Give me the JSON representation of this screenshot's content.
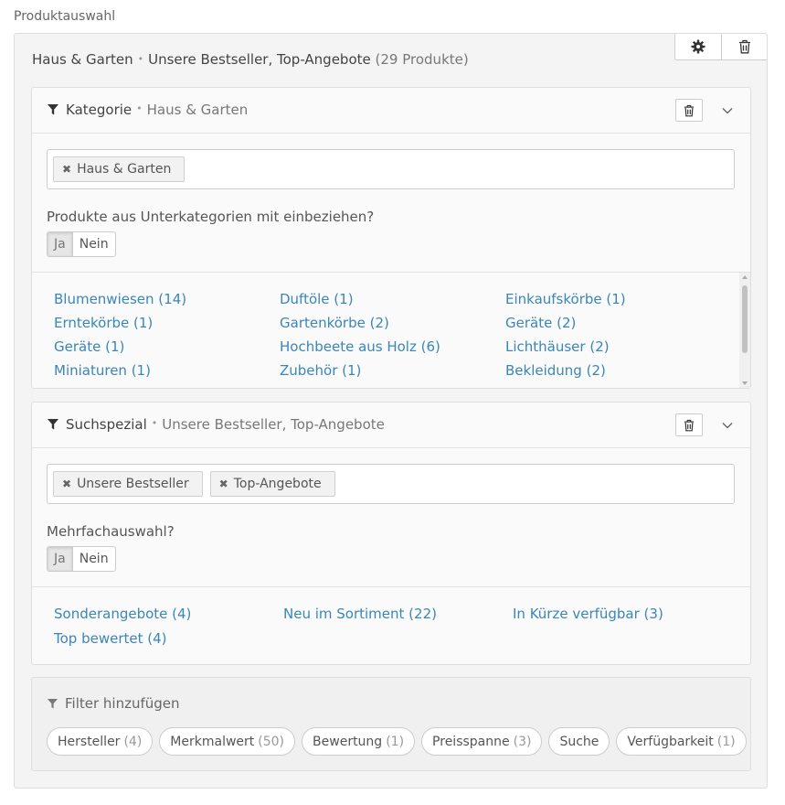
{
  "page_label": "Produktauswahl",
  "summary": {
    "category": "Haus & Garten",
    "special": "Unsere Bestseller, Top-Angebote",
    "count": "(29 Produkte)"
  },
  "category_panel": {
    "title": "Kategorie",
    "value": "Haus & Garten",
    "tags": [
      "Haus & Garten"
    ],
    "question": "Produkte aus Unterkategorien mit einbeziehen?",
    "toggle": {
      "yes": "Ja",
      "no": "Nein",
      "selected": "Ja"
    },
    "links": [
      "Blumenwiesen (14)",
      "Duftöle (1)",
      "Einkaufskörbe (1)",
      "Erntekörbe (1)",
      "Gartenkörbe (2)",
      "Geräte (2)",
      "Geräte (1)",
      "Hochbeete aus Holz (6)",
      "Lichthäuser (2)",
      "Miniaturen (1)",
      "Zubehör (1)",
      "Bekleidung (2)"
    ]
  },
  "special_panel": {
    "title": "Suchspezial",
    "value": "Unsere Bestseller, Top-Angebote",
    "tags": [
      "Unsere Bestseller",
      "Top-Angebote"
    ],
    "question": "Mehrfachauswahl?",
    "toggle": {
      "yes": "Ja",
      "no": "Nein",
      "selected": "Ja"
    },
    "links": [
      "Sonderangebote (4)",
      "Neu im Sortiment (22)",
      "In Kürze verfügbar (3)",
      "Top bewertet (4)"
    ]
  },
  "filter_add": {
    "title": "Filter hinzufügen",
    "pills": [
      {
        "label": "Hersteller",
        "count": "(4)"
      },
      {
        "label": "Merkmalwert",
        "count": "(50)"
      },
      {
        "label": "Bewertung",
        "count": "(1)"
      },
      {
        "label": "Preisspanne",
        "count": "(3)"
      },
      {
        "label": "Suche",
        "count": ""
      },
      {
        "label": "Verfügbarkeit",
        "count": "(1)"
      }
    ]
  },
  "colors": {
    "link": "#3a86b8",
    "panel_bg": "#fafafa",
    "outer_bg": "#f4f4f4"
  }
}
